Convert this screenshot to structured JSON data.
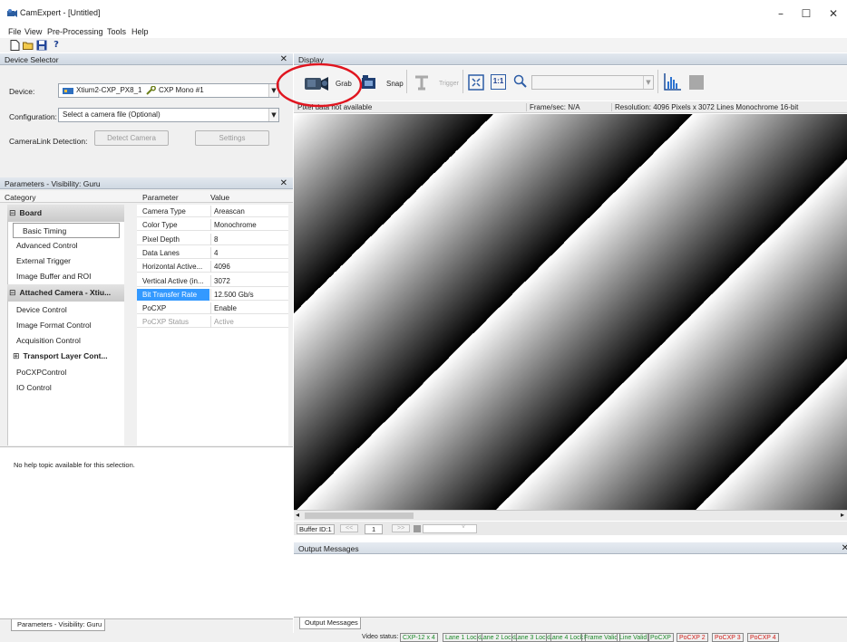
{
  "window": {
    "title": "CamExpert - [Untitled]",
    "minimize": "–",
    "maximize": "☐",
    "close": "✕"
  },
  "menu": [
    "File",
    "View",
    "Pre-Processing",
    "Tools",
    "Help"
  ],
  "toolbar_icons": [
    "new-file-icon",
    "open-folder-icon",
    "save-icon",
    "help-icon"
  ],
  "device_selector": {
    "header": "Device Selector",
    "close": "✕",
    "device_label": "Device:",
    "device_value": "Xtium2-CXP_PX8_1",
    "device_config": "CXP Mono #1",
    "config_label": "Configuration:",
    "config_value": "Select a camera file (Optional)",
    "detection_label": "CameraLink Detection:",
    "detect_button": "Detect Camera",
    "settings_button": "Settings"
  },
  "parameters": {
    "header": "Parameters - Visibility: Guru",
    "close": "✕",
    "col_category": "Category",
    "col_parameter": "Parameter",
    "col_value": "Value",
    "categories": [
      {
        "label": "Board",
        "type": "group",
        "expander": "⊟"
      },
      {
        "label": "Basic Timing",
        "type": "selected"
      },
      {
        "label": "Advanced Control",
        "type": "item"
      },
      {
        "label": "External Trigger",
        "type": "item"
      },
      {
        "label": "Image Buffer and ROI",
        "type": "item"
      },
      {
        "label": "Attached Camera - Xtiu...",
        "type": "group",
        "expander": "⊟"
      },
      {
        "label": "Device Control",
        "type": "item"
      },
      {
        "label": "Image Format Control",
        "type": "item"
      },
      {
        "label": "Acquisition Control",
        "type": "item"
      },
      {
        "label": "Transport Layer Cont...",
        "type": "subgroup",
        "expander": "⊞"
      },
      {
        "label": "PoCXPControl",
        "type": "item"
      },
      {
        "label": "IO Control",
        "type": "item"
      }
    ],
    "rows": [
      {
        "param": "Camera Type",
        "value": "Areascan",
        "state": "normal"
      },
      {
        "param": "Color Type",
        "value": "Monochrome",
        "state": "normal"
      },
      {
        "param": "Pixel Depth",
        "value": "8",
        "state": "normal"
      },
      {
        "param": "Data Lanes",
        "value": "4",
        "state": "normal"
      },
      {
        "param": "Horizontal Active...",
        "value": "4096",
        "state": "normal"
      },
      {
        "param": "Vertical Active (in...",
        "value": "3072",
        "state": "normal"
      },
      {
        "param": "Bit Transfer Rate",
        "value": "12.500 Gb/s",
        "state": "selected"
      },
      {
        "param": "PoCXP",
        "value": "Enable",
        "state": "normal"
      },
      {
        "param": "PoCXP Status",
        "value": "Active",
        "state": "disabled"
      }
    ]
  },
  "help": {
    "text": "No help topic available for this selection.",
    "tab": "Parameters - Visibility: Guru"
  },
  "display": {
    "header": "Display",
    "grab": "Grab",
    "snap": "Snap",
    "trigger": "Trigger",
    "one_to_one": "1:1",
    "zoom_value": "",
    "status_pixel": "Pixel data not available",
    "status_fps": "Frame/sec: N/A",
    "status_res": "Resolution: 4096 Pixels x 3072 Lines  Monochrome 16-bit",
    "buffer_label": "Buffer ID:1",
    "buffer_prev": "<<",
    "buffer_num": "1",
    "buffer_next": ">>",
    "buffer_combo_arrow": "˅"
  },
  "output": {
    "header": "Output Messages",
    "tab": "Output Messages",
    "close": "✕"
  },
  "video_status": {
    "label": "Video status:",
    "items": [
      {
        "text": "CXP-12 x 4",
        "color": "#1d8a2a"
      },
      {
        "text": "Lane 1 Lock",
        "color": "#1d8a2a"
      },
      {
        "text": "Lane 2 Lock",
        "color": "#1d8a2a"
      },
      {
        "text": "Lane 3 Lock",
        "color": "#1d8a2a"
      },
      {
        "text": "Lane 4 Lock",
        "color": "#1d8a2a"
      },
      {
        "text": "Frame Valid",
        "color": "#1d8a2a"
      },
      {
        "text": "Line Valid",
        "color": "#1d8a2a"
      },
      {
        "text": "PoCXP",
        "color": "#1d8a2a"
      },
      {
        "text": "PoCXP 2",
        "color": "#d0201b"
      },
      {
        "text": "PoCXP 3",
        "color": "#d0201b"
      },
      {
        "text": "PoCXP 4",
        "color": "#d0201b"
      }
    ]
  },
  "colors": {
    "selection": "#3399ff",
    "header_bg": "#dde4ec",
    "annotation_circle": "#e0151f"
  }
}
